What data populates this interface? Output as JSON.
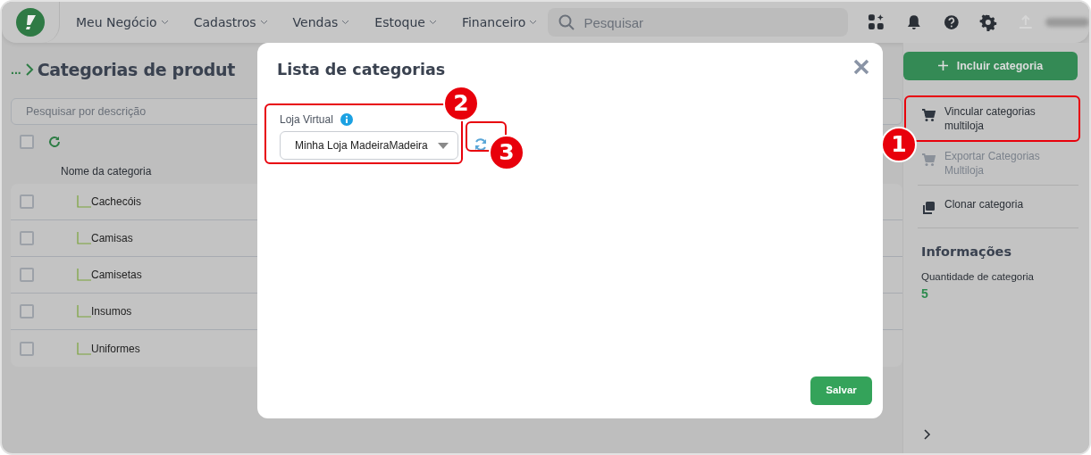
{
  "navbar": {
    "menu": [
      {
        "label": "Meu Negócio"
      },
      {
        "label": "Cadastros"
      },
      {
        "label": "Vendas"
      },
      {
        "label": "Estoque"
      },
      {
        "label": "Financeiro"
      }
    ],
    "search": {
      "placeholder": "Pesquisar"
    }
  },
  "page": {
    "breadcrumb": "...",
    "title": "Categorias de produt",
    "search": {
      "placeholder": "Pesquisar por descrição"
    },
    "select_all": {
      "checked": false
    },
    "column": "Nome da categoria",
    "rows": [
      {
        "name": "Cachecóis",
        "checked": false
      },
      {
        "name": "Camisas",
        "checked": false
      },
      {
        "name": "Camisetas",
        "checked": false
      },
      {
        "name": "Insumos",
        "checked": false
      },
      {
        "name": "Uniformes",
        "checked": false
      }
    ]
  },
  "sidebar": {
    "primary_button": "Incluir categoria",
    "actions": [
      {
        "label": "Vincular categorias multiloja",
        "disabled": false,
        "kind": "cart"
      },
      {
        "label": "Exportar Categorias Multiloja",
        "disabled": true,
        "kind": "cart"
      },
      {
        "label": "Clonar categoria",
        "disabled": false,
        "kind": "clone"
      }
    ],
    "info_title": "Informações",
    "info_label": "Quantidade de categoria",
    "info_value": "5"
  },
  "modal": {
    "title": "Lista de categorias",
    "field": {
      "label": "Loja Virtual",
      "value": "Minha Loja MadeiraMadeira"
    },
    "save_button": "Salvar"
  },
  "annotations": [
    {
      "number": "2"
    },
    {
      "number": "3"
    },
    {
      "number": "1"
    }
  ]
}
